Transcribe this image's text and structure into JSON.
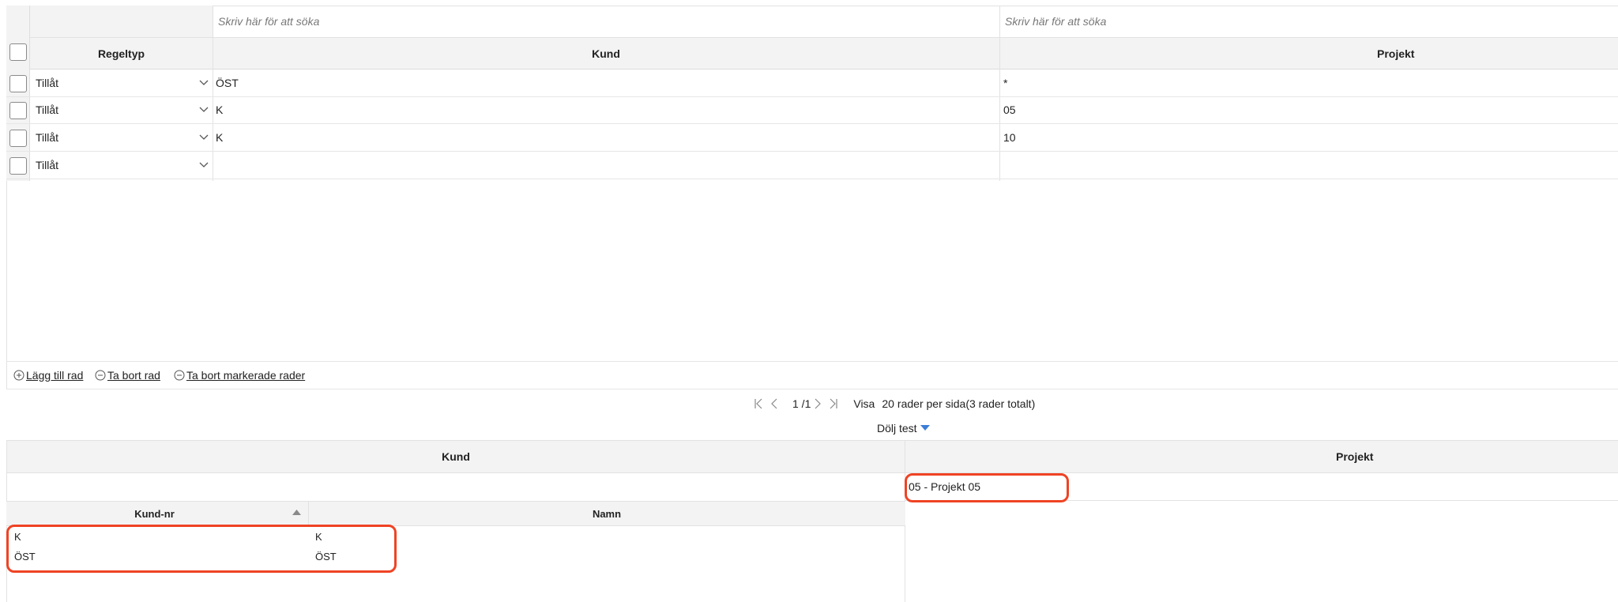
{
  "rules_table": {
    "search_placeholders": {
      "kund": "Skriv här för att söka",
      "projekt": "Skriv här för att söka"
    },
    "columns": {
      "regeltyp": "Regeltyp",
      "kund": "Kund",
      "projekt": "Projekt"
    },
    "rows": [
      {
        "regeltyp": "Tillåt",
        "kund": "ÖST",
        "projekt": "*"
      },
      {
        "regeltyp": "Tillåt",
        "kund": "K",
        "projekt": "05"
      },
      {
        "regeltyp": "Tillåt",
        "kund": "K",
        "projekt": "10"
      },
      {
        "regeltyp": "Tillåt",
        "kund": "",
        "projekt": ""
      }
    ]
  },
  "actions": {
    "add_row": "Lägg till rad",
    "remove_row": "Ta bort rad",
    "remove_selected": "Ta bort markerade rader"
  },
  "pager": {
    "page": "1 /1",
    "show_label": "Visa",
    "per_page": "20",
    "per_page_suffix": "rader per sida",
    "total": "(3 rader totalt)"
  },
  "toggle": {
    "label": "Dölj test"
  },
  "test_panel": {
    "kund_title": "Kund",
    "projekt_title": "Projekt",
    "projekt_value": "05 - Projekt 05",
    "kund_columns": {
      "nr": "Kund-nr",
      "namn": "Namn"
    },
    "kund_rows": [
      {
        "nr": "K",
        "namn": "K"
      },
      {
        "nr": "ÖST",
        "namn": "ÖST"
      }
    ]
  },
  "colors": {
    "highlight": "#ef4324",
    "header_bg": "#f3f3f3",
    "caret_blue": "#3b7dd8"
  },
  "icons": {
    "dropdown": "chevron-down-icon",
    "add": "plus-circle-icon",
    "remove": "minus-circle-icon",
    "first": "first-page-icon",
    "prev": "prev-page-icon",
    "next": "next-page-icon",
    "last": "last-page-icon",
    "sort": "sort-asc-icon",
    "toggle": "caret-down-icon"
  }
}
